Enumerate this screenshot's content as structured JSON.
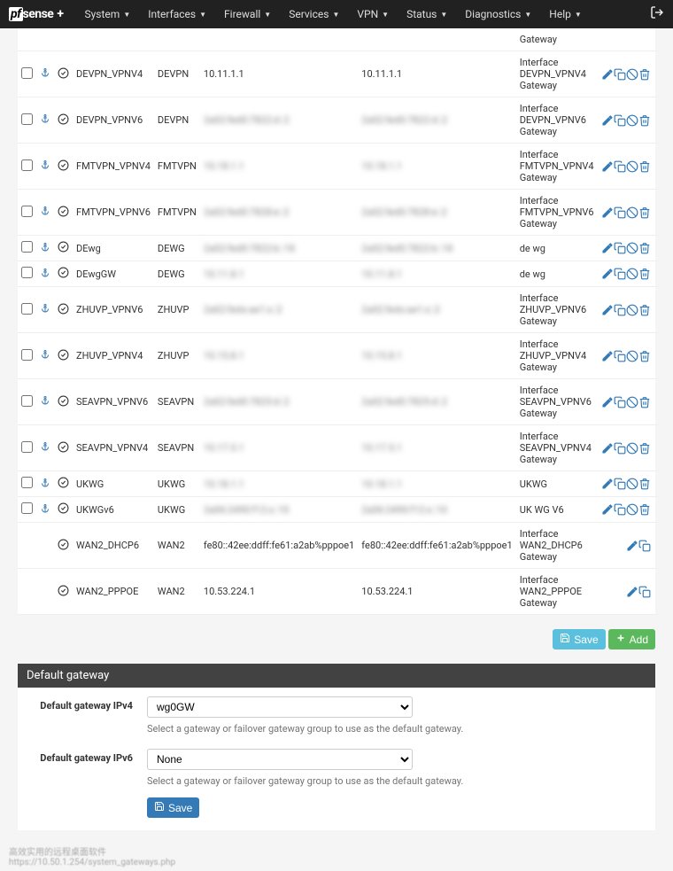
{
  "nav": {
    "brand_pf": "pf",
    "brand_sense": "sense",
    "brand_plus": "+",
    "items": [
      "System",
      "Interfaces",
      "Firewall",
      "Services",
      "VPN",
      "Status",
      "Diagnostics",
      "Help"
    ]
  },
  "header_row_desc": "Gateway",
  "rows": [
    {
      "name": "DEVPN_VPNV4",
      "iface": "DEVPN",
      "gw": "10.11.1.1",
      "mon": "10.11.1.1",
      "desc": "Interface DEVPN_VPNV4 Gateway",
      "blur": false,
      "actions": [
        "edit",
        "copy",
        "disable",
        "del"
      ],
      "anchor": true,
      "check": true
    },
    {
      "name": "DEVPN_VPNV6",
      "iface": "DEVPN",
      "gw": "2a02:fed0:7822:d::2",
      "mon": "2a02:fed0:7822:d::2",
      "desc": "Interface DEVPN_VPNV6 Gateway",
      "blur": true,
      "actions": [
        "edit",
        "copy",
        "disable",
        "del"
      ],
      "anchor": true,
      "check": true
    },
    {
      "name": "FMTVPN_VPNV4",
      "iface": "FMTVPN",
      "gw": "10.18.1.1",
      "mon": "10.18.1.1",
      "desc": "Interface FMTVPN_VPNV4 Gateway",
      "blur": true,
      "actions": [
        "edit",
        "copy",
        "disable",
        "del"
      ],
      "anchor": true,
      "check": true
    },
    {
      "name": "FMTVPN_VPNV6",
      "iface": "FMTVPN",
      "gw": "2a02:fed0:7828:e::2",
      "mon": "2a02:fed0:7828:e::2",
      "desc": "Interface FMTVPN_VPNV6 Gateway",
      "blur": true,
      "actions": [
        "edit",
        "copy",
        "disable",
        "del"
      ],
      "anchor": true,
      "check": true
    },
    {
      "name": "DEwg",
      "iface": "DEWG",
      "gw": "2a02:fed0:7822:b::18",
      "mon": "2a02:fed0:7822:b::18",
      "desc": "de wg",
      "blur": true,
      "actions": [
        "edit",
        "copy",
        "disable",
        "del"
      ],
      "anchor": true,
      "check": true
    },
    {
      "name": "DEwgGW",
      "iface": "DEWG",
      "gw": "10.11.8.1",
      "mon": "10.11.8.1",
      "desc": "de wg",
      "blur": true,
      "actions": [
        "edit",
        "copy",
        "disable",
        "del"
      ],
      "anchor": true,
      "check": true
    },
    {
      "name": "ZHUVP_VPNV6",
      "iface": "ZHUVP",
      "gw": "2a02:fedx:ae1:x::2",
      "mon": "2a02:fedx:ae1:x::2",
      "desc": "Interface ZHUVP_VPNV6 Gateway",
      "blur": true,
      "actions": [
        "edit",
        "copy",
        "disable",
        "del"
      ],
      "anchor": true,
      "check": true
    },
    {
      "name": "ZHUVP_VPNV4",
      "iface": "ZHUVP",
      "gw": "10.15.8.1",
      "mon": "10.15.8.1",
      "desc": "Interface ZHUVP_VPNV4 Gateway",
      "blur": true,
      "actions": [
        "edit",
        "copy",
        "disable",
        "del"
      ],
      "anchor": true,
      "check": true
    },
    {
      "name": "SEAVPN_VPNV6",
      "iface": "SEAVPN",
      "gw": "2a02:fed0:7825:d::2",
      "mon": "2a02:fed0:7825:d::2",
      "desc": "Interface SEAVPN_VPNV6 Gateway",
      "blur": true,
      "actions": [
        "edit",
        "copy",
        "disable",
        "del"
      ],
      "anchor": true,
      "check": true
    },
    {
      "name": "SEAVPN_VPNV4",
      "iface": "SEAVPN",
      "gw": "10.17.5.1",
      "mon": "10.17.5.1",
      "desc": "Interface SEAVPN_VPNV4 Gateway",
      "blur": true,
      "actions": [
        "edit",
        "copy",
        "disable",
        "del"
      ],
      "anchor": true,
      "check": true
    },
    {
      "name": "UKWG",
      "iface": "UKWG",
      "gw": "10.18.1.1",
      "mon": "10.18.1.1",
      "desc": "UKWG",
      "blur": true,
      "actions": [
        "edit",
        "copy",
        "disable",
        "del"
      ],
      "anchor": true,
      "check": true
    },
    {
      "name": "UKWGv6",
      "iface": "UKWG",
      "gw": "2a06:2490:f12:x::10",
      "mon": "2a06:2490:f12:x::10",
      "desc": "UK WG V6",
      "blur": true,
      "actions": [
        "edit",
        "copy",
        "disable",
        "del"
      ],
      "anchor": true,
      "check": true
    },
    {
      "name": "WAN2_DHCP6",
      "iface": "WAN2",
      "gw": "fe80::42ee:ddff:fe61:a2ab%pppoe1",
      "mon": "fe80::42ee:ddff:fe61:a2ab%pppoe1",
      "desc": "Interface WAN2_DHCP6 Gateway",
      "blur": false,
      "actions": [
        "edit",
        "copy"
      ],
      "anchor": false,
      "check": false
    },
    {
      "name": "WAN2_PPPOE",
      "iface": "WAN2",
      "gw": "10.53.224.1",
      "mon": "10.53.224.1",
      "desc": "Interface WAN2_PPPOE Gateway",
      "blur": false,
      "actions": [
        "edit",
        "copy"
      ],
      "anchor": false,
      "check": false
    }
  ],
  "buttons": {
    "save": "Save",
    "add": "Add"
  },
  "section": {
    "title": "Default gateway",
    "ipv4_label": "Default gateway IPv4",
    "ipv4_value": "wg0GW",
    "ipv6_label": "Default gateway IPv6",
    "ipv6_value": "None",
    "help": "Select a gateway or failover gateway group to use as the default gateway.",
    "save": "Save"
  },
  "footer": {
    "line1": "高效实用的远程桌面软件",
    "line2": "https://10.50.1.254/system_gateways.php"
  }
}
